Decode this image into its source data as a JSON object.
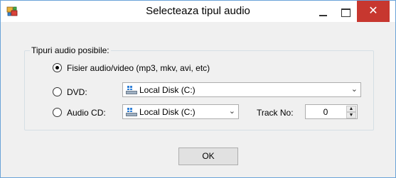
{
  "window": {
    "title": "Selecteaza tipul audio",
    "close_glyph": "✕",
    "icons": [
      "app-icon",
      "minimize-icon",
      "maximize-icon",
      "close-icon"
    ]
  },
  "group": {
    "legend": "Tipuri audio posibile:"
  },
  "options": [
    {
      "label": "Fisier audio/video (mp3, mkv, avi, etc)",
      "checked": true
    },
    {
      "label": "DVD:",
      "checked": false
    },
    {
      "label": "Audio CD:",
      "checked": false
    }
  ],
  "dvd_drive": {
    "value": "Local Disk (C:)",
    "icon": "drive-icon"
  },
  "cd_drive": {
    "value": "Local Disk (C:)",
    "icon": "drive-icon"
  },
  "track": {
    "label": "Track No:",
    "value": "0"
  },
  "ok_button": {
    "label": "OK"
  },
  "colors": {
    "close_button": "#c7372f",
    "border": "#6aa3d8"
  }
}
